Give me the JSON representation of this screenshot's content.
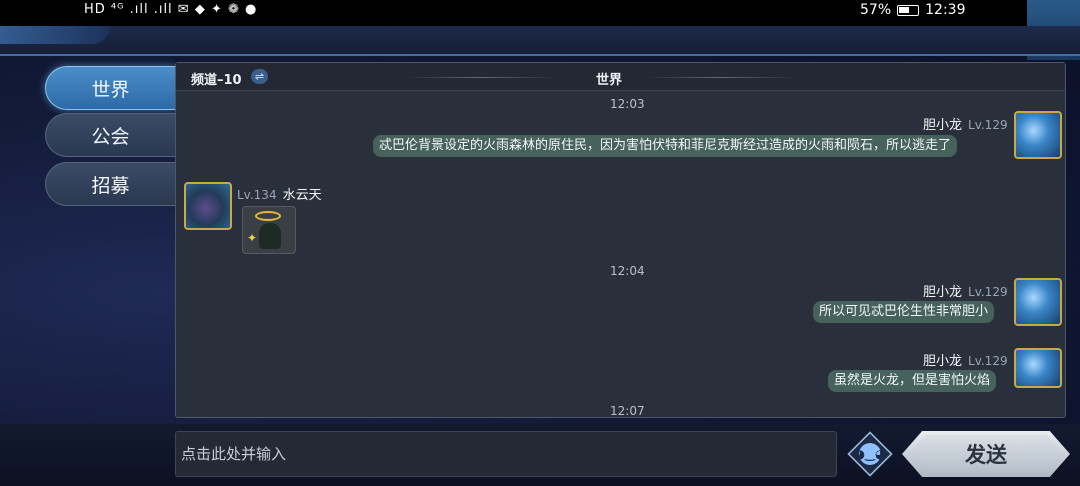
{
  "status_bar": {
    "left_text": "HD ⁴ᴳ .ıll .ıll ✉ ◆ ✦ ❁ ●",
    "battery": "57%",
    "time": "12:39"
  },
  "sidebar": {
    "tabs": [
      {
        "label": "世界",
        "active": true
      },
      {
        "label": "公会",
        "active": false
      },
      {
        "label": "招募",
        "active": false
      }
    ]
  },
  "chat_panel": {
    "channel": "频道–10",
    "swap_icon": "swap-arrows-icon",
    "title": "世界",
    "messages": [
      {
        "time": "12:03"
      },
      {
        "side": "right",
        "name": "胆小龙",
        "level": "Lv.129",
        "text": "忒巴伦背景设定的火雨森林的原住民，因为害怕伏特和菲尼克斯经过造成的火雨和陨石，所以逃走了"
      },
      {
        "side": "left",
        "name": "水云天",
        "level": "Lv.134",
        "sticker": "character-sticker"
      },
      {
        "time": "12:04"
      },
      {
        "side": "right",
        "name": "胆小龙",
        "level": "Lv.129",
        "text": "所以可见忒巴伦生性非常胆小"
      },
      {
        "side": "right",
        "name": "胆小龙",
        "level": "Lv.129",
        "text": "虽然是火龙，但是害怕火焰"
      },
      {
        "time": "12:07"
      }
    ]
  },
  "input": {
    "placeholder": "点击此处并输入"
  },
  "emoji_button": {
    "icon": "smiley-icon"
  },
  "send_button": {
    "label": "发送"
  },
  "colors": {
    "bubble": "#46625b",
    "active_tab": "#3d7dbb",
    "panel": "#2a303b"
  }
}
